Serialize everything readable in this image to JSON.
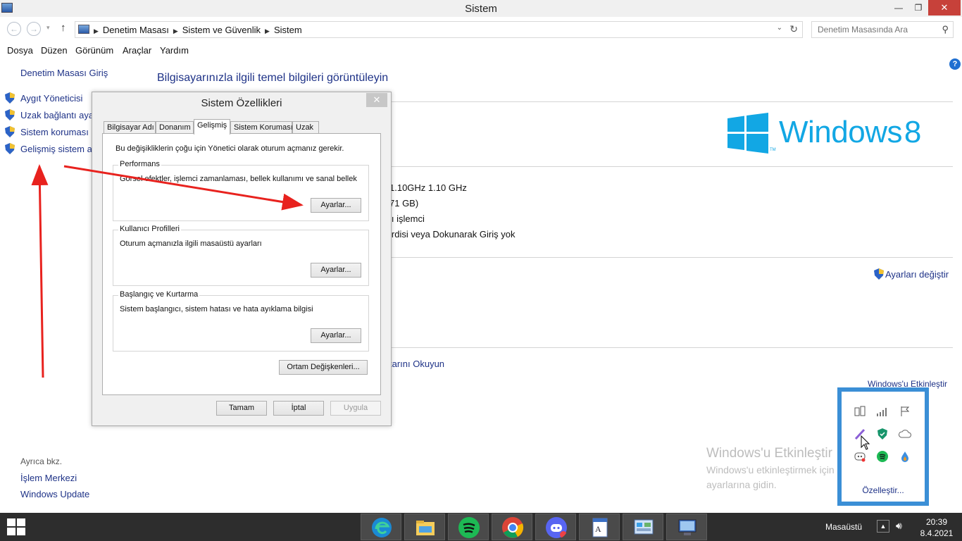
{
  "window": {
    "title": "Sistem",
    "min_glyph": "—",
    "max_glyph": "❐",
    "close_glyph": "✕"
  },
  "nav": {
    "back_glyph": "←",
    "forward_glyph": "→",
    "recent_glyph": "▾",
    "up_glyph": "↑"
  },
  "address": {
    "crumbs": [
      "Denetim Masası",
      "Sistem ve Güvenlik",
      "Sistem"
    ],
    "sep": "▶",
    "dropdown_glyph": "⌄",
    "refresh_glyph": "↻"
  },
  "search": {
    "placeholder": "Denetim Masasında Ara",
    "icon_glyph": "⚲"
  },
  "menu": [
    "Dosya",
    "Düzen",
    "Görünüm",
    "Araçlar",
    "Yardım"
  ],
  "sidebar": {
    "home": "Denetim Masası Giriş",
    "links": [
      "Aygıt Yöneticisi",
      "Uzak bağlantı ayarları",
      "Sistem koruması",
      "Gelişmiş sistem ayarları"
    ],
    "see_also": "Ayrıca bkz.",
    "see_also_links": [
      "İşlem Merkezi",
      "Windows Update"
    ]
  },
  "main": {
    "heading": "Bilgisayarınızla ilgili temel bilgileri görüntüleyin",
    "help_glyph": "?",
    "edition_logo_text": "Windows",
    "edition_logo_number": "8",
    "edition_logo_tm": "TM",
    "info_lines": [
      "1.10GHz   1.10 GHz",
      "71 GB)",
      "lı işlemci",
      "irdisi veya Dokunarak Giriş yok"
    ],
    "change_settings": "Ayarları değiştir",
    "read_link": "tarını Okuyun",
    "activate_link": "Windows'u Etkinleştir",
    "watermark_title": "Windows'u Etkinleştir",
    "watermark_text": "Windows'u etkinleştirmek için kişisel bilgisayar ayarlarına gidin."
  },
  "dialog": {
    "title": "Sistem Özellikleri",
    "close_glyph": "✕",
    "tabs": [
      "Bilgisayar Adı",
      "Donanım",
      "Gelişmiş",
      "Sistem Koruması",
      "Uzak"
    ],
    "active_tab": "Gelişmiş",
    "note": "Bu değişikliklerin çoğu için Yönetici olarak oturum açmanız gerekir.",
    "groups": [
      {
        "title": "Performans",
        "desc": "Görsel efektler, işlemci zamanlaması, bellek kullanımı ve sanal bellek",
        "button": "Ayarlar..."
      },
      {
        "title": "Kullanıcı Profilleri",
        "desc": "Oturum açmanızla ilgili masaüstü ayarları",
        "button": "Ayarlar..."
      },
      {
        "title": "Başlangıç ve Kurtarma",
        "desc": "Sistem başlangıcı, sistem hatası ve hata ayıklama bilgisi",
        "button": "Ayarlar..."
      }
    ],
    "env_button": "Ortam Değişkenleri...",
    "ok": "Tamam",
    "cancel": "İptal",
    "apply": "Uygula"
  },
  "tray_popup": {
    "customize": "Özelleştir..."
  },
  "taskbar": {
    "desktop_label": "Masaüstü",
    "time": "20:39",
    "date": "8.4.2021",
    "apps": [
      "edge",
      "file-explorer",
      "spotify",
      "chrome",
      "discord",
      "wordpad",
      "control-panel",
      "system"
    ]
  },
  "colors": {
    "link": "#1e3287",
    "windows_logo": "#12a7e4",
    "annotation_arrow": "#e8221e",
    "taskbar": "#2d2d2d"
  }
}
